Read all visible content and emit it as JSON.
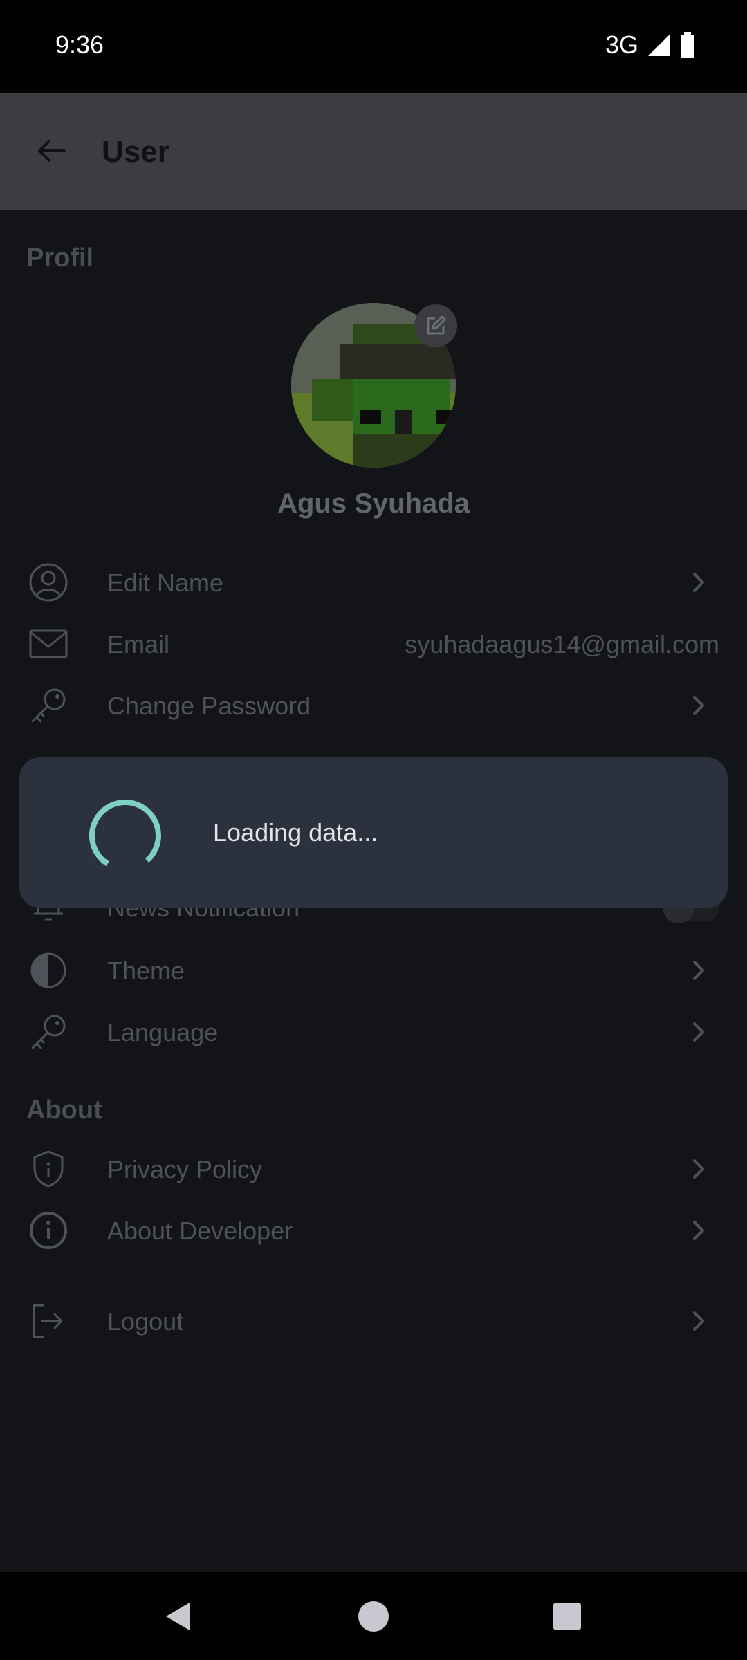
{
  "status_bar": {
    "time": "9:36",
    "network": "3G"
  },
  "app_bar": {
    "title": "User",
    "back_icon": "arrow-left-icon"
  },
  "profile": {
    "section_title": "Profil",
    "user_name": "Agus Syuhada",
    "edit_avatar_icon": "edit-icon"
  },
  "items": {
    "edit_name": "Edit Name",
    "email_label": "Email",
    "email_value": "syuhadaagus14@gmail.com",
    "change_password": "Change Password",
    "news_notification": "News Notification",
    "theme": "Theme",
    "language": "Language"
  },
  "about": {
    "section_title": "About",
    "privacy_policy": "Privacy Policy",
    "about_developer": "About Developer",
    "logout": "Logout"
  },
  "loading": {
    "text": "Loading data...",
    "spinner_color": "#7fcfc6"
  },
  "colors": {
    "dialog_bg": "#2b323d",
    "content_bg": "#121418",
    "app_bar_bg": "#3b3d41"
  }
}
